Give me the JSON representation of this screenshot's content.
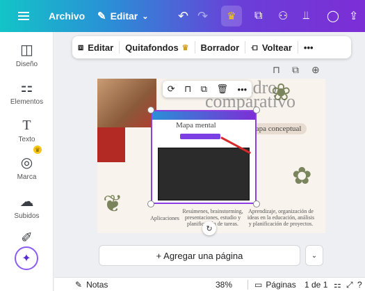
{
  "topbar": {
    "menu_icon": "hamburger-icon",
    "archivo": "Archivo",
    "editar": "Editar",
    "editar_icon": "pencil-icon",
    "undo_icon": "undo-icon",
    "redo_icon": "redo-icon",
    "crown_icon": "crown-icon",
    "right_icons": [
      "copy-icon",
      "people-icon",
      "chart-icon",
      "comment-icon",
      "share-icon"
    ]
  },
  "sidebar": {
    "items": [
      {
        "label": "Diseño",
        "icon": "layout-icon"
      },
      {
        "label": "Elementos",
        "icon": "shapes-icon"
      },
      {
        "label": "Texto",
        "icon": "text-icon"
      },
      {
        "label": "Marca",
        "icon": "brand-icon"
      },
      {
        "label": "Subidos",
        "icon": "upload-icon"
      },
      {
        "label": "",
        "icon": "draw-icon"
      }
    ],
    "magic_icon": "magic-sparkle-icon"
  },
  "context_toolbar": {
    "editar": "Editar",
    "quitafondos": "Quitafondos",
    "borrador": "Borrador",
    "voltear": "Voltear",
    "more": "•••"
  },
  "page_content": {
    "title_line1": "Cuadro",
    "title_line2": "comparativo",
    "pill_left": "Mapa mental",
    "pill_right": "Mapa conceptual",
    "col_left": "Aplicaciones",
    "col_mid": "Resúmenes, brainstorming, presentaciones, estudio y planificación de tareas.",
    "col_right": "Aprendizaje, organización de ideas en la educación, análisis y planificación de proyectos."
  },
  "add_page": {
    "label": "+ Agregar una página"
  },
  "bottombar": {
    "notas": "Notas",
    "zoom": "38%",
    "paginas": "Páginas",
    "page_count": "1 de 1"
  }
}
